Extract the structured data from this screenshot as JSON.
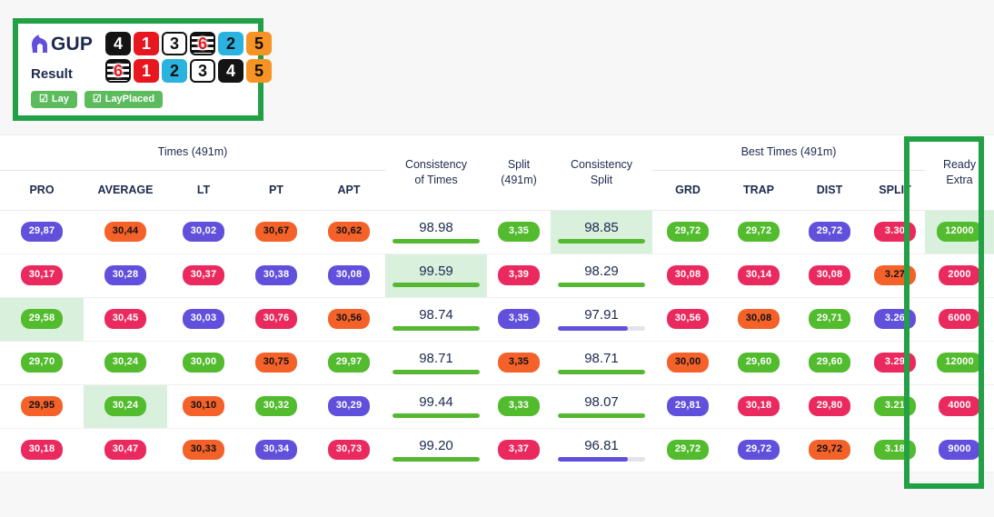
{
  "brand": {
    "name": "GUP",
    "icon": "horse-head-icon"
  },
  "result_card": {
    "result_label": "Result",
    "forecast_row": [
      {
        "num": "4",
        "trap": 4
      },
      {
        "num": "1",
        "trap": 1
      },
      {
        "num": "3",
        "trap": 3
      },
      {
        "num": "6",
        "trap": 6
      },
      {
        "num": "2",
        "trap": 2
      },
      {
        "num": "5",
        "trap": 5
      }
    ],
    "result_row": [
      {
        "num": "6",
        "trap": 6
      },
      {
        "num": "1",
        "trap": 1
      },
      {
        "num": "2",
        "trap": 2
      },
      {
        "num": "3",
        "trap": 3
      },
      {
        "num": "4",
        "trap": 4
      },
      {
        "num": "5",
        "trap": 5
      }
    ],
    "tags": [
      {
        "label": "Lay",
        "icon": "checkbox-checked-icon"
      },
      {
        "label": "LayPlaced",
        "icon": "checkbox-checked-icon"
      }
    ]
  },
  "colors": {
    "accent_green": "#22a045",
    "highlight_bg": "#d8f0dc",
    "badge_purple": "#6050dc",
    "badge_orange": "#f4622a",
    "badge_pink": "#ea2a5f",
    "badge_green": "#52bb2e",
    "tag_green": "#5cbb5c",
    "page_bg": "#f7f7f8"
  },
  "table": {
    "groups": [
      {
        "label": "Times (491m)",
        "span": 5,
        "underline": true
      },
      {
        "label": "",
        "span": 1,
        "underline": false
      },
      {
        "label": "",
        "span": 1,
        "underline": false
      },
      {
        "label": "",
        "span": 1,
        "underline": false
      },
      {
        "label": "Best Times (491m)",
        "span": 4,
        "underline": true
      },
      {
        "label": "",
        "span": 1,
        "underline": false
      }
    ],
    "columns": [
      "PRO",
      "AVERAGE",
      "LT",
      "PT",
      "APT",
      "Consistency of Times",
      "Split (491m)",
      "Consistency Split",
      "GRD",
      "TRAP",
      "DIST",
      "SPLIT",
      "Ready Extra"
    ],
    "column_lines": {
      "consistency_of_times": [
        "Consistency",
        "of Times"
      ],
      "split": [
        "Split",
        "(491m)"
      ],
      "consistency_split": [
        "Consistency",
        "Split"
      ],
      "ready_extra": [
        "Ready",
        "Extra"
      ]
    },
    "rows": [
      {
        "pro": {
          "v": "29,87",
          "c": "purple",
          "hl": false
        },
        "average": {
          "v": "30,44",
          "c": "orange",
          "hl": false
        },
        "lt": {
          "v": "30,02",
          "c": "purple",
          "hl": false
        },
        "pt": {
          "v": "30,67",
          "c": "orange",
          "hl": false
        },
        "apt": {
          "v": "30,62",
          "c": "orange",
          "hl": false
        },
        "cot": {
          "v": "98.98",
          "bar": 100,
          "c": "green",
          "hl": false
        },
        "split": {
          "v": "3,35",
          "c": "green",
          "hl": false
        },
        "cs": {
          "v": "98.85",
          "bar": 100,
          "c": "green",
          "hl": true
        },
        "grd": {
          "v": "29,72",
          "c": "green",
          "hl": false
        },
        "trap": {
          "v": "29,72",
          "c": "green",
          "hl": false
        },
        "dist": {
          "v": "29,72",
          "c": "purple",
          "hl": false
        },
        "spl": {
          "v": "3.30",
          "c": "pink",
          "hl": false
        },
        "ready": {
          "v": "12000",
          "c": "green",
          "hl": true
        }
      },
      {
        "pro": {
          "v": "30,17",
          "c": "pink",
          "hl": false
        },
        "average": {
          "v": "30,28",
          "c": "purple",
          "hl": false
        },
        "lt": {
          "v": "30,37",
          "c": "pink",
          "hl": false
        },
        "pt": {
          "v": "30,38",
          "c": "purple",
          "hl": false
        },
        "apt": {
          "v": "30,08",
          "c": "purple",
          "hl": false
        },
        "cot": {
          "v": "99.59",
          "bar": 100,
          "c": "green",
          "hl": true
        },
        "split": {
          "v": "3,39",
          "c": "pink",
          "hl": false
        },
        "cs": {
          "v": "98.29",
          "bar": 100,
          "c": "green",
          "hl": false
        },
        "grd": {
          "v": "30,08",
          "c": "pink",
          "hl": false
        },
        "trap": {
          "v": "30,14",
          "c": "pink",
          "hl": false
        },
        "dist": {
          "v": "30,08",
          "c": "pink",
          "hl": false
        },
        "spl": {
          "v": "3.27",
          "c": "orange",
          "hl": false
        },
        "ready": {
          "v": "2000",
          "c": "pink",
          "hl": false
        }
      },
      {
        "pro": {
          "v": "29,58",
          "c": "green",
          "hl": true
        },
        "average": {
          "v": "30,45",
          "c": "pink",
          "hl": false
        },
        "lt": {
          "v": "30,03",
          "c": "purple",
          "hl": false
        },
        "pt": {
          "v": "30,76",
          "c": "pink",
          "hl": false
        },
        "apt": {
          "v": "30,56",
          "c": "orange",
          "hl": false
        },
        "cot": {
          "v": "98.74",
          "bar": 100,
          "c": "green",
          "hl": false
        },
        "split": {
          "v": "3,35",
          "c": "purple",
          "hl": false
        },
        "cs": {
          "v": "97.91",
          "bar": 80,
          "c": "purple",
          "hl": false
        },
        "grd": {
          "v": "30,56",
          "c": "pink",
          "hl": false
        },
        "trap": {
          "v": "30,08",
          "c": "orange",
          "hl": false
        },
        "dist": {
          "v": "29,71",
          "c": "green",
          "hl": false
        },
        "spl": {
          "v": "3.26",
          "c": "purple",
          "hl": false
        },
        "ready": {
          "v": "6000",
          "c": "pink",
          "hl": false
        }
      },
      {
        "pro": {
          "v": "29,70",
          "c": "green",
          "hl": false
        },
        "average": {
          "v": "30,24",
          "c": "green",
          "hl": false
        },
        "lt": {
          "v": "30,00",
          "c": "green",
          "hl": false
        },
        "pt": {
          "v": "30,75",
          "c": "orange",
          "hl": false
        },
        "apt": {
          "v": "29,97",
          "c": "green",
          "hl": false
        },
        "cot": {
          "v": "98.71",
          "bar": 100,
          "c": "green",
          "hl": false
        },
        "split": {
          "v": "3,35",
          "c": "orange",
          "hl": false
        },
        "cs": {
          "v": "98.71",
          "bar": 100,
          "c": "green",
          "hl": false
        },
        "grd": {
          "v": "30,00",
          "c": "orange",
          "hl": false
        },
        "trap": {
          "v": "29,60",
          "c": "green",
          "hl": false
        },
        "dist": {
          "v": "29,60",
          "c": "green",
          "hl": false
        },
        "spl": {
          "v": "3.29",
          "c": "pink",
          "hl": false
        },
        "ready": {
          "v": "12000",
          "c": "green",
          "hl": false
        }
      },
      {
        "pro": {
          "v": "29,95",
          "c": "orange",
          "hl": false
        },
        "average": {
          "v": "30,24",
          "c": "green",
          "hl": true
        },
        "lt": {
          "v": "30,10",
          "c": "orange",
          "hl": false
        },
        "pt": {
          "v": "30,32",
          "c": "green",
          "hl": false
        },
        "apt": {
          "v": "30,29",
          "c": "purple",
          "hl": false
        },
        "cot": {
          "v": "99.44",
          "bar": 100,
          "c": "green",
          "hl": false
        },
        "split": {
          "v": "3,33",
          "c": "green",
          "hl": false
        },
        "cs": {
          "v": "98.07",
          "bar": 100,
          "c": "green",
          "hl": false
        },
        "grd": {
          "v": "29,81",
          "c": "purple",
          "hl": false
        },
        "trap": {
          "v": "30,18",
          "c": "pink",
          "hl": false
        },
        "dist": {
          "v": "29,80",
          "c": "pink",
          "hl": false
        },
        "spl": {
          "v": "3.21",
          "c": "green",
          "hl": false
        },
        "ready": {
          "v": "4000",
          "c": "pink",
          "hl": false
        }
      },
      {
        "pro": {
          "v": "30,18",
          "c": "pink",
          "hl": false
        },
        "average": {
          "v": "30,47",
          "c": "pink",
          "hl": false
        },
        "lt": {
          "v": "30,33",
          "c": "orange",
          "hl": false
        },
        "pt": {
          "v": "30,34",
          "c": "purple",
          "hl": false
        },
        "apt": {
          "v": "30,73",
          "c": "pink",
          "hl": false
        },
        "cot": {
          "v": "99.20",
          "bar": 100,
          "c": "green",
          "hl": false
        },
        "split": {
          "v": "3,37",
          "c": "pink",
          "hl": false
        },
        "cs": {
          "v": "96.81",
          "bar": 80,
          "c": "purple",
          "hl": false
        },
        "grd": {
          "v": "29,72",
          "c": "green",
          "hl": false
        },
        "trap": {
          "v": "29,72",
          "c": "purple",
          "hl": false
        },
        "dist": {
          "v": "29,72",
          "c": "orange",
          "hl": false
        },
        "spl": {
          "v": "3.18",
          "c": "green",
          "hl": false
        },
        "ready": {
          "v": "9000",
          "c": "purple",
          "hl": false
        }
      }
    ]
  }
}
